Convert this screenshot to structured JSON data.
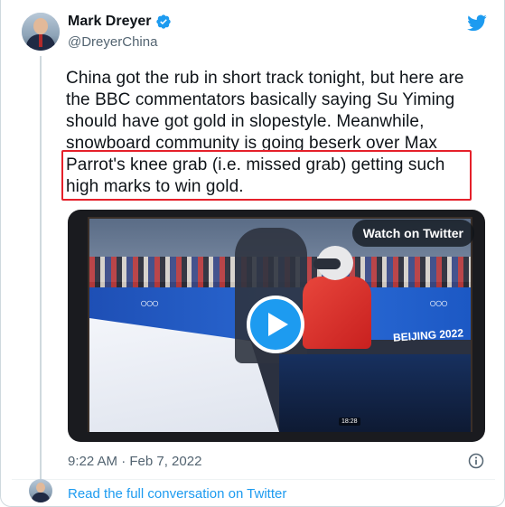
{
  "author": {
    "display_name": "Mark Dreyer",
    "handle": "@DreyerChina",
    "verified": true
  },
  "tweet": {
    "lines": [
      "China got the rub in short track tonight, but here are",
      "the BBC commentators basically saying Su Yiming",
      "should have got gold in slopestyle. Meanwhile,",
      "snowboard community is going beserk over Max",
      "Parrot's knee grab (i.e. missed grab) getting such",
      "high marks to win gold."
    ]
  },
  "media": {
    "watch_label": "Watch on Twitter",
    "play_icon": "play-icon",
    "video_timestamp": "18:28",
    "broadcast_text": "BEIJING 2022"
  },
  "meta": {
    "timestamp": "9:22 AM · Feb 7, 2022",
    "info_icon": "info-icon"
  },
  "footer": {
    "read_more_label": "Read the full conversation on Twitter"
  },
  "colors": {
    "brand": "#1d9bf0",
    "highlight": "#e5202a",
    "secondary_text": "#536471"
  }
}
